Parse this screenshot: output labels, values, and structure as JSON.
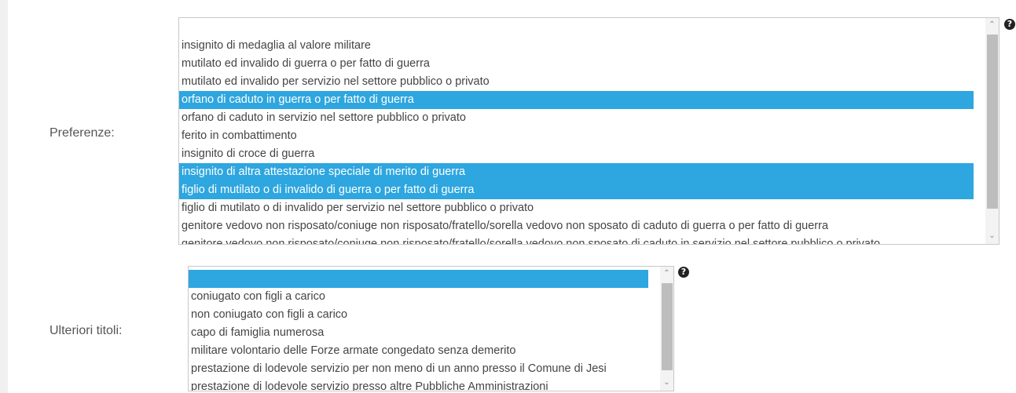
{
  "preferenze": {
    "label": "Preferenze:",
    "options": [
      {
        "text": "insignito di medaglia al valore militare",
        "selected": false
      },
      {
        "text": "mutilato ed invalido di guerra o per fatto di guerra",
        "selected": false
      },
      {
        "text": "mutilato ed invalido per servizio nel settore pubblico o privato",
        "selected": false
      },
      {
        "text": "orfano di caduto in guerra o per fatto di guerra",
        "selected": true
      },
      {
        "text": "orfano di caduto in servizio nel settore pubblico o privato",
        "selected": false
      },
      {
        "text": "ferito in combattimento",
        "selected": false
      },
      {
        "text": "insignito di croce di guerra",
        "selected": false
      },
      {
        "text": "insignito di altra attestazione speciale di merito di guerra",
        "selected": true
      },
      {
        "text": "figlio di mutilato o di invalido di guerra o per fatto di guerra",
        "selected": true
      },
      {
        "text": "figlio di mutilato o di invalido per servizio nel settore pubblico o privato",
        "selected": false
      },
      {
        "text": "genitore vedovo non risposato/coniuge non risposato/fratello/sorella vedovo non sposato di caduto di guerra o per fatto di guerra",
        "selected": false
      },
      {
        "text": "genitore vedovo non risposato/coniuge non risposato/fratello/sorella vedovo non sposato di caduto in servizio nel settore pubblico o privato",
        "selected": false
      }
    ]
  },
  "ulteriori": {
    "label": "Ulteriori titoli:",
    "options": [
      {
        "text": "",
        "selected": true
      },
      {
        "text": "coniugato con figli a carico",
        "selected": false
      },
      {
        "text": "non coniugato con figli a carico",
        "selected": false
      },
      {
        "text": "capo di famiglia numerosa",
        "selected": false
      },
      {
        "text": "militare volontario delle Forze armate congedato senza demerito",
        "selected": false
      },
      {
        "text": "prestazione di lodevole servizio per non meno di un anno presso il Comune di Jesi",
        "selected": false
      },
      {
        "text": "prestazione di lodevole servizio presso altre Pubbliche Amministrazioni",
        "selected": false
      }
    ]
  },
  "help_glyph": "?",
  "icons": {
    "scroll_up": "chevron-up-icon",
    "scroll_down": "chevron-down-icon",
    "help": "question-circle-icon"
  },
  "colors": {
    "selected": "#2ea6df"
  }
}
